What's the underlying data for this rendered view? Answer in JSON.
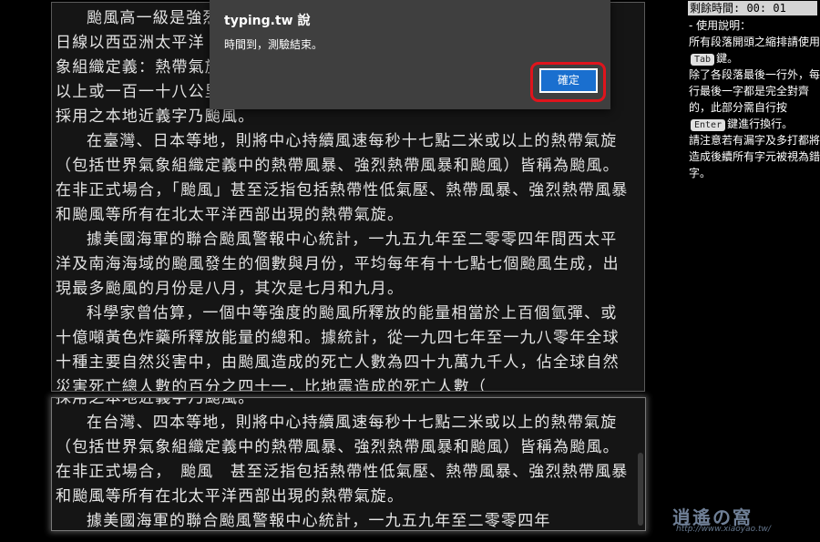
{
  "reference": {
    "paragraphs": [
      {
        "text": "颱風高一級是強烈",
        "cont": false
      },
      {
        "text": "日線以西亞洲太平洋",
        "cont": true
      },
      {
        "text": "象組織定義：熱帶氣旋",
        "cont": true
      },
      {
        "text": "以上或一百一十八公里",
        "cont": true
      },
      {
        "text": "採用之本地近義字乃颱風。",
        "cont": true
      },
      {
        "text": "在臺灣、日本等地，則將中心持續風速每秒十七點二米或以上的熱帶氣旋（包括世界氣象組織定義中的熱帶風暴、強烈熱帶風暴和颱風）皆稱為颱風。在非正式場合，「颱風」甚至泛指包括熱帶性低氣壓、熱帶風暴、強烈熱帶風暴和颱風等所有在北太平洋西部出現的熱帶氣旋。",
        "cont": false
      },
      {
        "text": "據美國海軍的聯合颱風警報中心統計，一九五九年至二零零四年間西太平洋及南海海域的颱風發生的個數與月份，平均每年有十七點七個颱風生成，出現最多颱風的月份是八月，其次是七月和九月。",
        "cont": false
      },
      {
        "text": "科學家曾估算，一個中等強度的颱風所釋放的能量相當於上百個氫彈、或十億噸黃色炸藥所釋放能量的總和。據統計，從一九四七年至一九八零年全球十種主要自然災害中，由颱風造成的死亡人數為四十九萬九千人，佔全球自然災害死亡總人數的百分之四十一，比地震造成的死亡人數（",
        "cont": false
      }
    ]
  },
  "typed": {
    "paragraphs": [
      {
        "text": "採用之本地近義字乃颱風。",
        "cont": true
      },
      {
        "text": "在台灣、四本等地，則將中心持續風速每秒十七點二米或以上的熱帶氣旋（包括世界氣象組織定義中的熱帶風暴、強烈熱帶風暴和颱風）皆稱為颱風。在非正式場合，　颱風　甚至泛指包括熱帶性低氣壓、熱帶風暴、強烈熱帶風暴和颱風等所有在北太平洋西部出現的熱帶氣旋。",
        "cont": false
      },
      {
        "text": "據美國海軍的聯合颱風警報中心統計，一九五九年至二零零四年",
        "cont": false
      }
    ]
  },
  "sidebar": {
    "timer": "剩餘時間: 00: 01",
    "lines": [
      "-  使用說明：",
      "所有段落開頭之縮排請使用",
      "鍵。",
      "除了各段落最後一行外，每行最後一字都是完全對齊的，此部分需自行按",
      "鍵進行換行。",
      "請注意若有漏字及多打都將造成後續所有字元被視為錯字。"
    ],
    "key_tab": "Tab",
    "key_enter": "Enter"
  },
  "dialog": {
    "title": "typing.tw 說",
    "message": "時間到，測驗結束。",
    "ok_label": "確定"
  },
  "watermark": {
    "text": "逍遙の窩",
    "url": "http://www.xiaoyao.tw/"
  }
}
